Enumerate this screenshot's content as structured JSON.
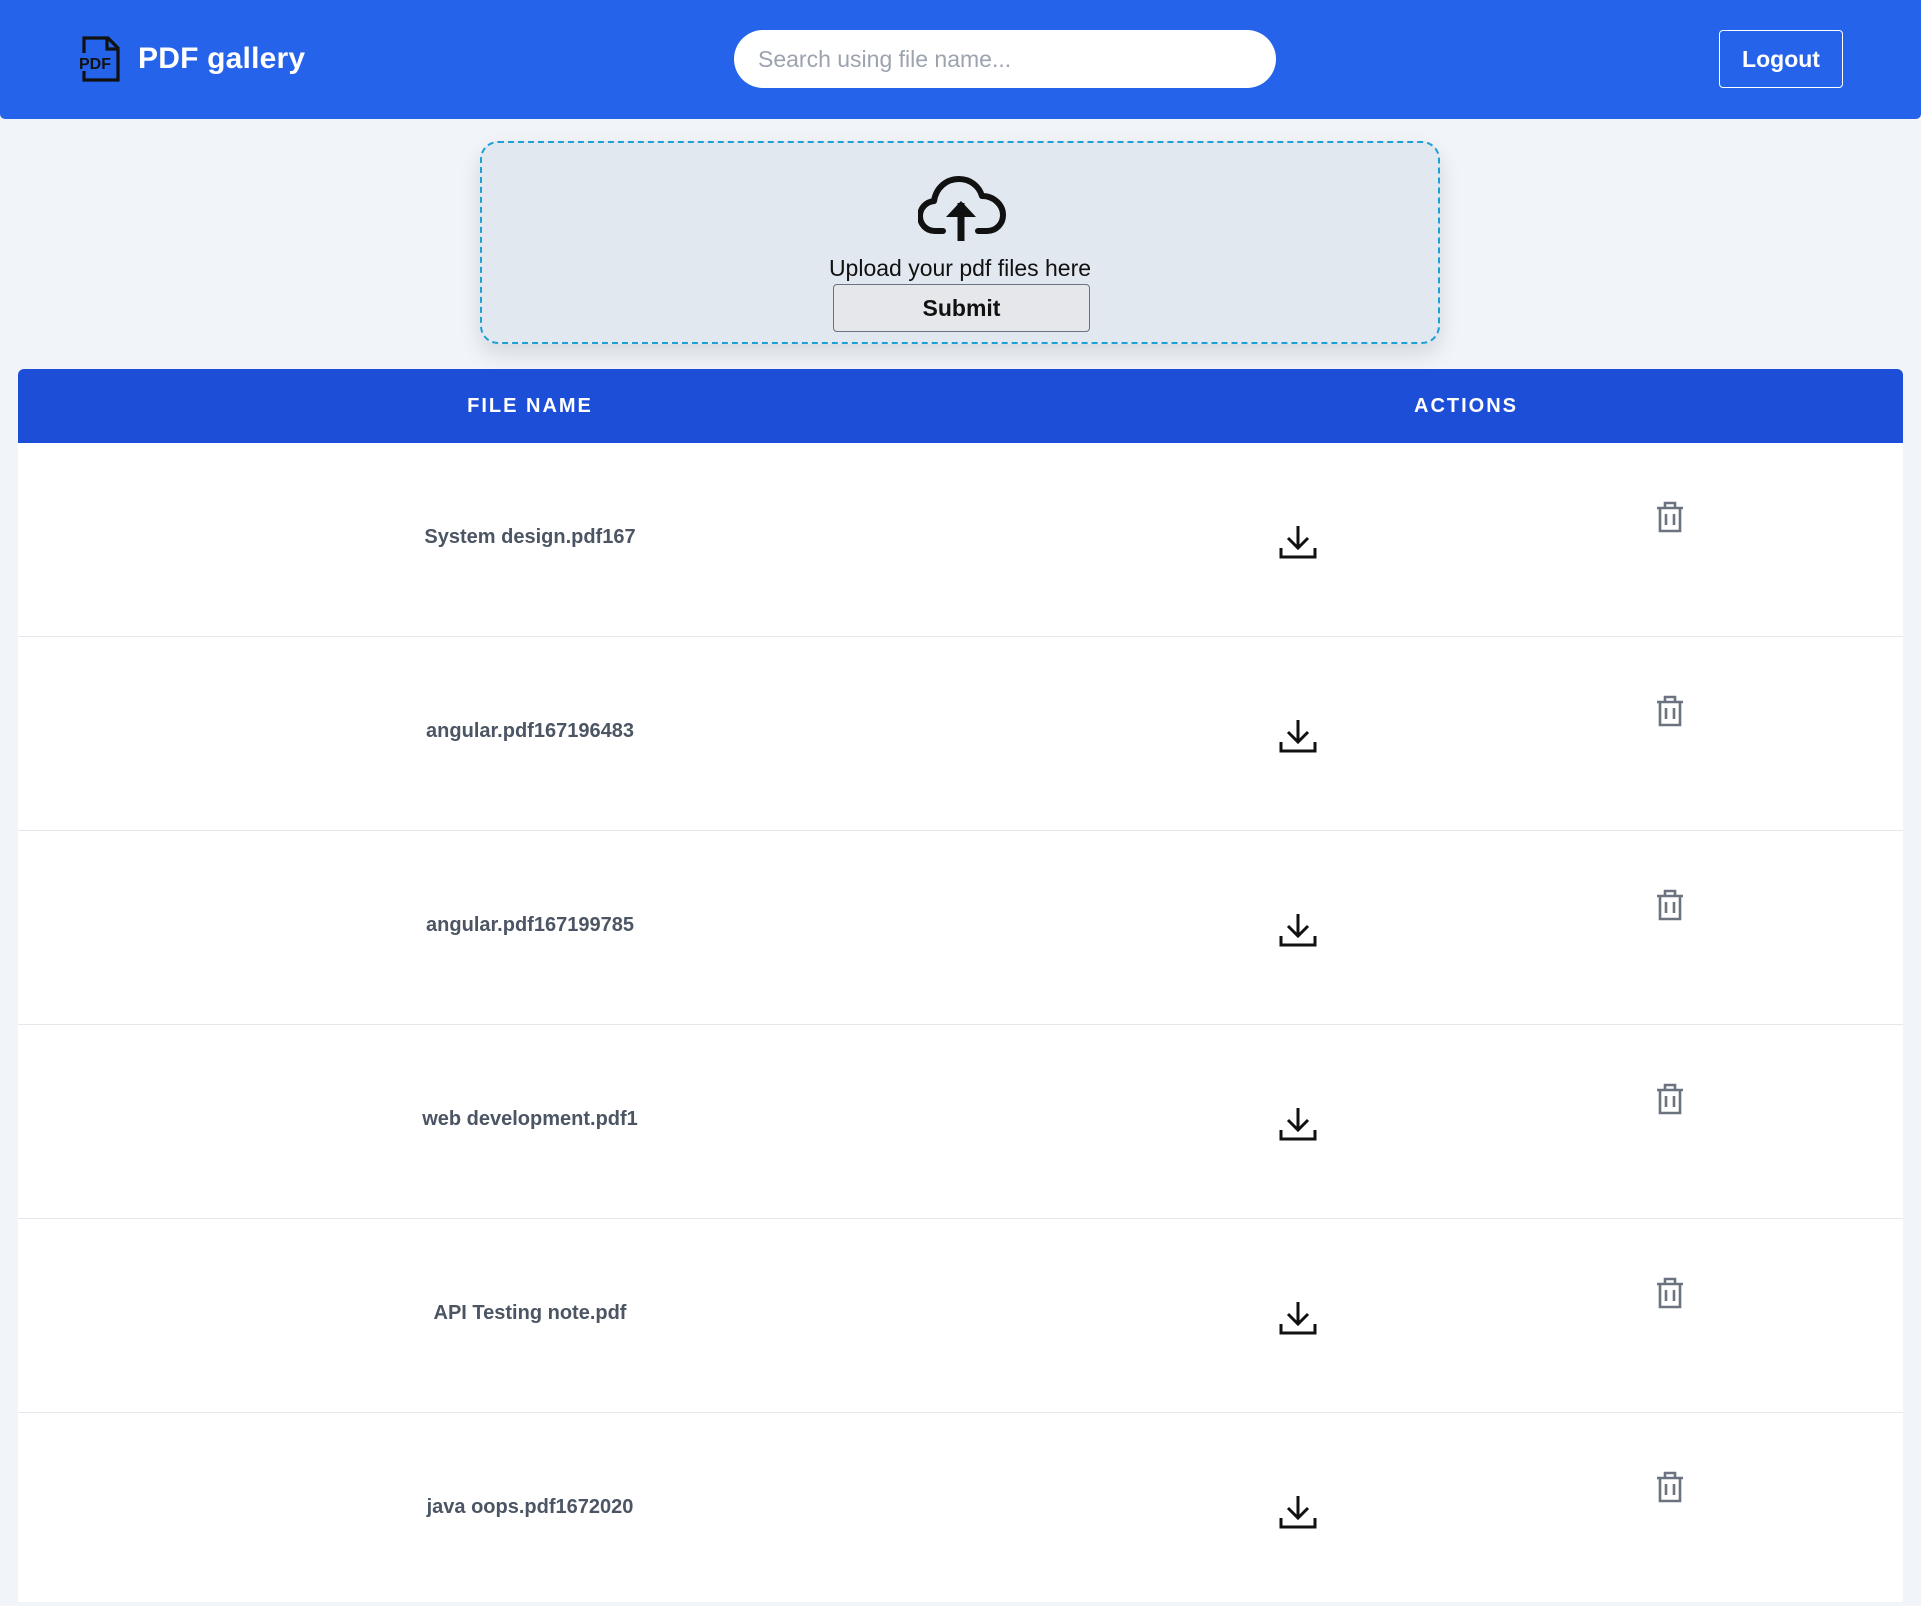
{
  "header": {
    "title": "PDF gallery",
    "logo_icon": "pdf-file-icon",
    "logout_label": "Logout"
  },
  "search": {
    "placeholder": "Search using file name...",
    "value": ""
  },
  "upload": {
    "icon": "cloud-upload-icon",
    "text": "Upload your pdf files here",
    "submit_label": "Submit"
  },
  "table": {
    "headers": {
      "file_name": "FILE NAME",
      "actions": "ACTIONS"
    },
    "action_icons": [
      "download-icon",
      "trash-icon"
    ],
    "rows": [
      {
        "file_name": "System design.pdf167"
      },
      {
        "file_name": "angular.pdf167196483"
      },
      {
        "file_name": "angular.pdf167199785"
      },
      {
        "file_name": "web development.pdf1"
      },
      {
        "file_name": "API Testing note.pdf"
      },
      {
        "file_name": "java oops.pdf1672020"
      }
    ]
  },
  "colors": {
    "navbar": "#2563eb",
    "table_header": "#1d4ed8",
    "page_background": "#f1f4f8",
    "upload_border": "#1ea0d6",
    "upload_background": "#e2e8f0"
  }
}
